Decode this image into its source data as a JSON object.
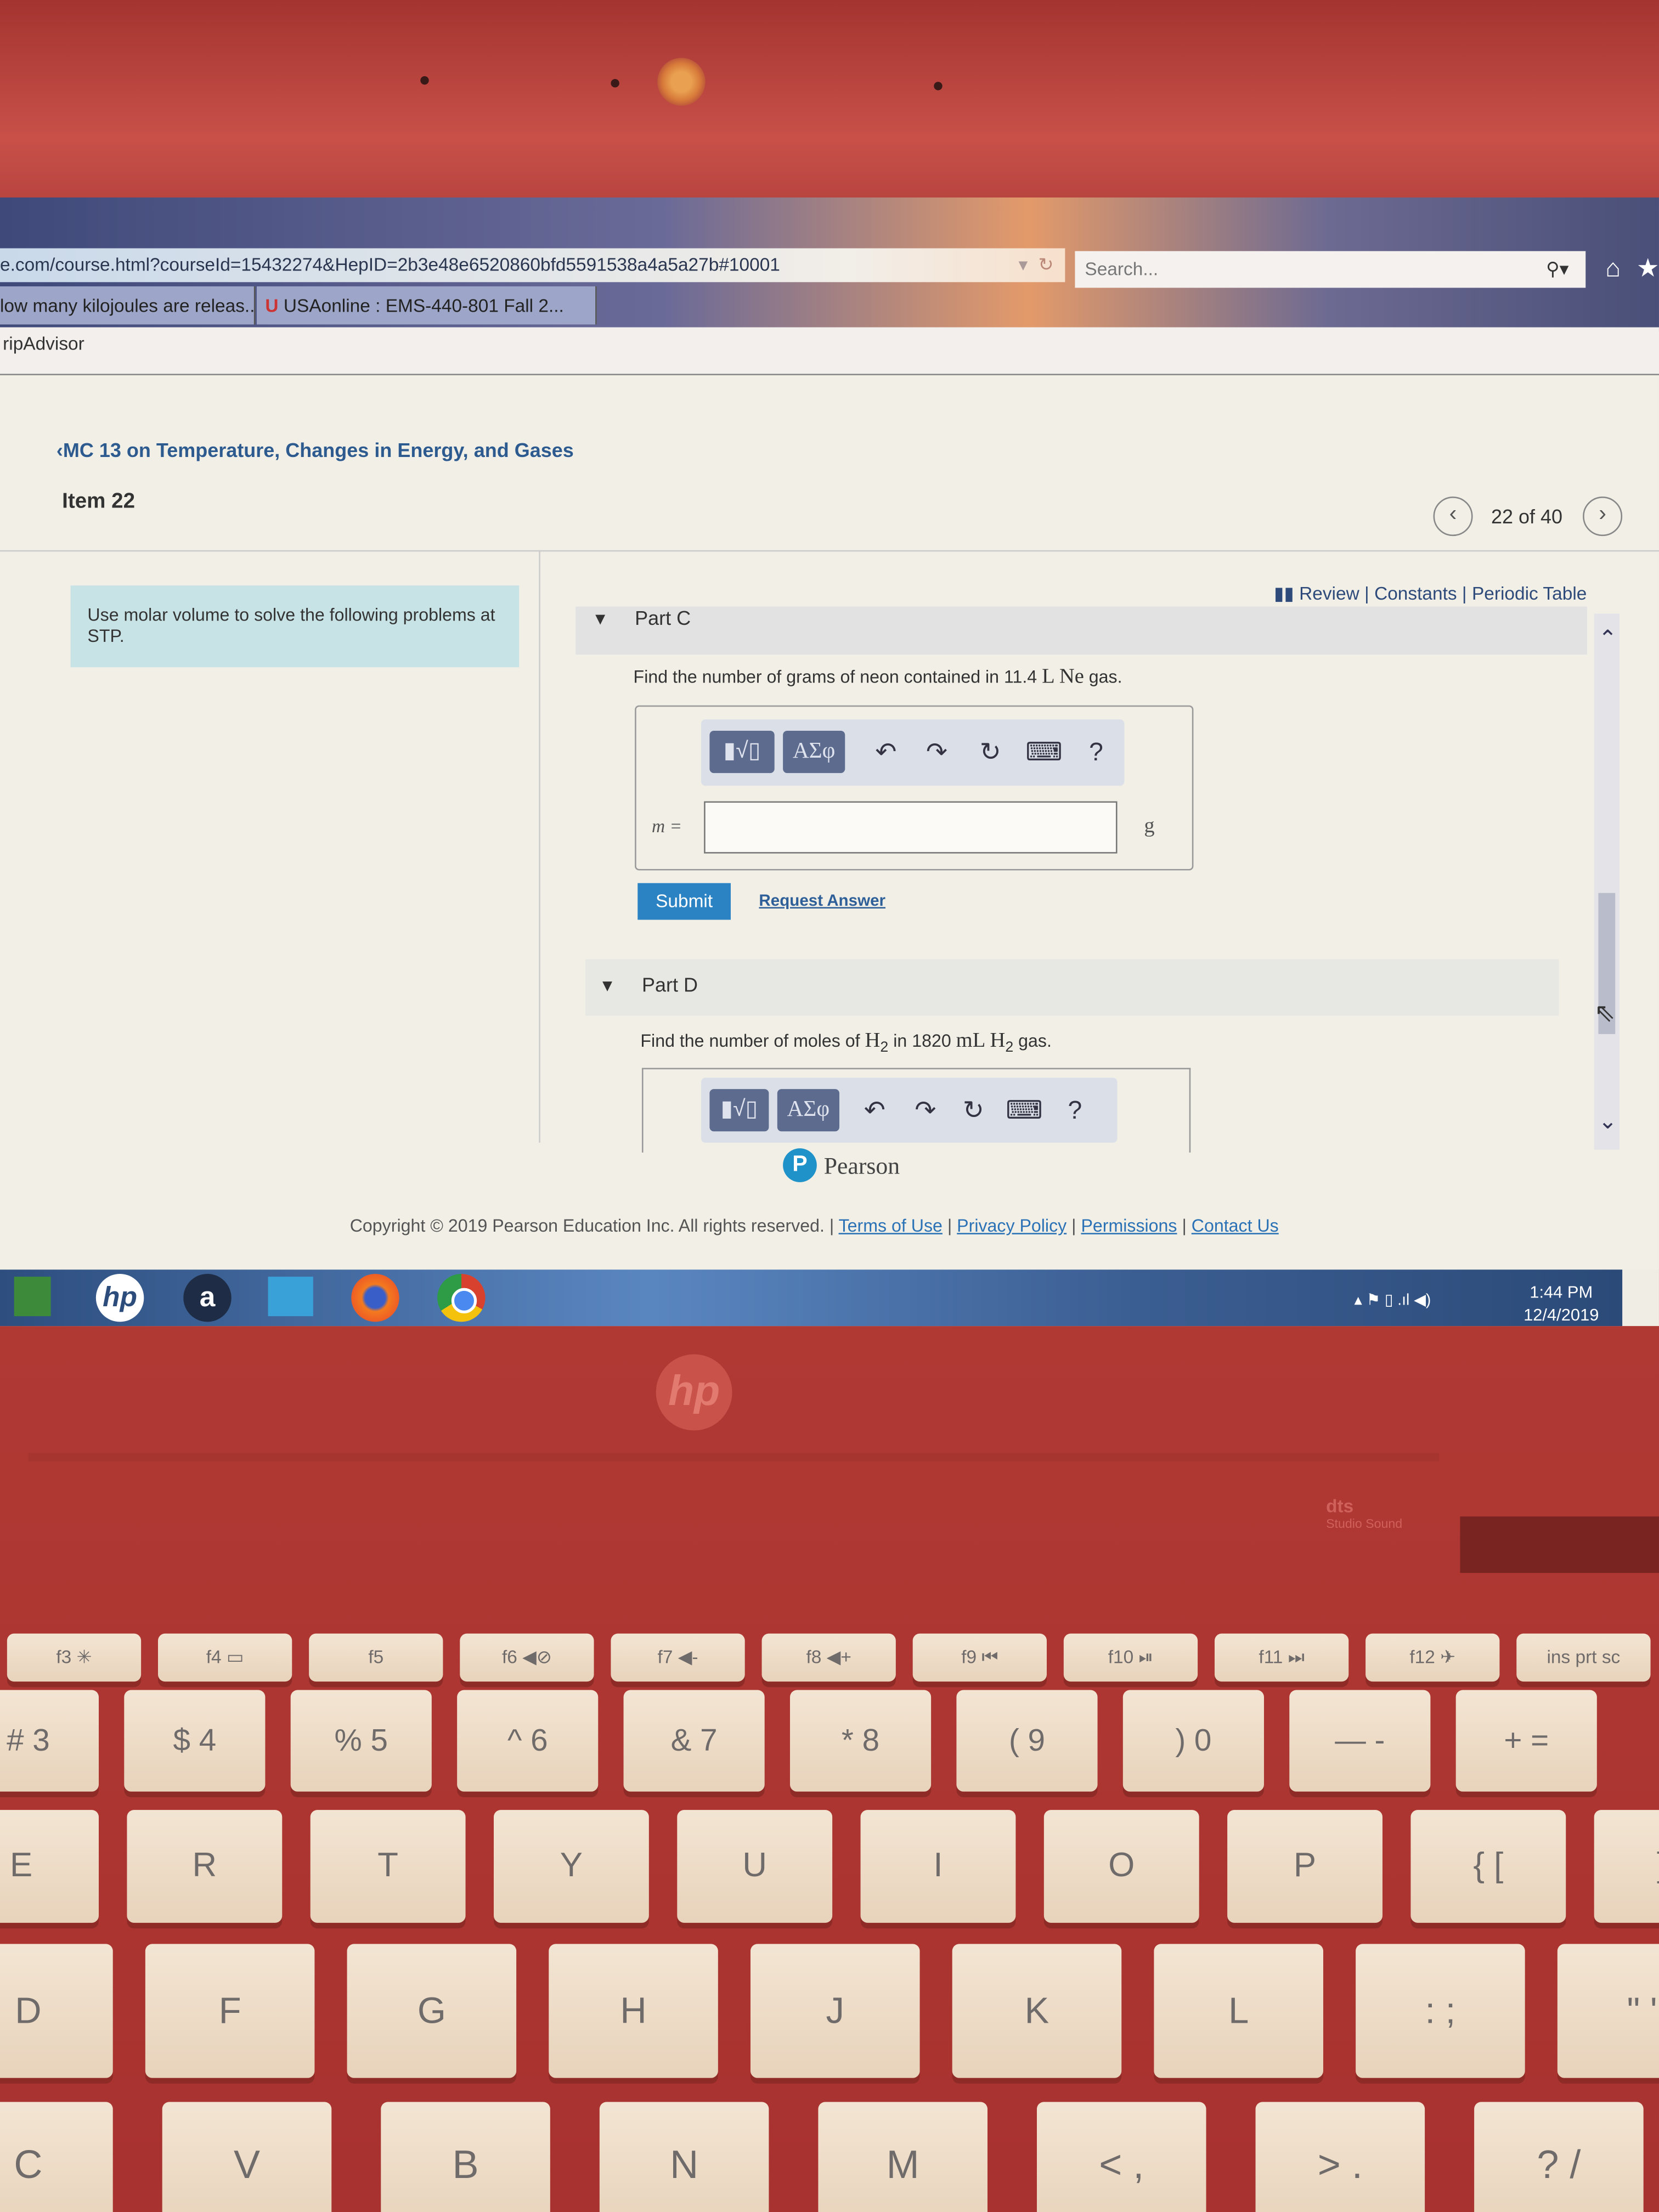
{
  "browser": {
    "url": "e.com/course.html?courseId=15432274&HepID=2b3e48e6520860bfd5591538a4a5a27b#10001",
    "search_placeholder": "Search...",
    "tabs": [
      {
        "label": "low many kilojoules are releas..."
      },
      {
        "label": "USAonline : EMS-440-801 Fall 2..."
      }
    ],
    "bookmark": "ripAdvisor"
  },
  "page": {
    "back_link": "MC 13 on Temperature, Changes in Energy, and Gases",
    "item_title": "Item 22",
    "pagination": "22 of 40",
    "intro": "Use molar volume to solve the following problems at STP.",
    "resources": {
      "review": "Review",
      "constants": "Constants",
      "periodic_table": "Periodic Table",
      "sep": "|"
    },
    "part_c": {
      "title": "Part C",
      "question_pre": "Find the number of grams of neon contained in 11.4 ",
      "question_unit": "L Ne",
      "question_post": " gas.",
      "toolbar": {
        "templates": "▮√▯",
        "greek": "ΑΣφ",
        "undo": "↶",
        "redo": "↷",
        "reset": "↻",
        "keyboard": "⌨",
        "help": "?"
      },
      "variable": "m =",
      "answer_value": "",
      "unit": "g",
      "submit": "Submit",
      "request_answer": "Request Answer"
    },
    "part_d": {
      "title": "Part D",
      "question_pre": "Find the number of moles of ",
      "h2_a": "H",
      "sub_a": "2",
      "mid": " in 1820 ",
      "unit": "mL H",
      "sub_b": "2",
      "question_post": " gas.",
      "toolbar": {
        "templates": "▮√▯",
        "greek": "ΑΣφ",
        "undo": "↶",
        "redo": "↷",
        "reset": "↻",
        "keyboard": "⌨",
        "help": "?"
      }
    },
    "pearson_logo": "Pearson",
    "footer": {
      "copyright": "Copyright © 2019 Pearson Education Inc. All rights reserved.",
      "links": [
        "Terms of Use",
        "Privacy Policy",
        "Permissions",
        "Contact Us"
      ]
    }
  },
  "taskbar": {
    "apps": [
      "store",
      "hp",
      "amazon",
      "weather",
      "firefox",
      "chrome"
    ],
    "amazon_label": "a",
    "hp_label": "hp",
    "time": "1:44 PM",
    "date": "12/4/2019"
  },
  "laptop": {
    "logo": "hp",
    "audio_badge": "dts",
    "audio_sub": "Studio Sound",
    "keys": {
      "fn": [
        "f3 ✳",
        "f4 ▭",
        "f5",
        "f6 ◀⊘",
        "f7 ◀-",
        "f8 ◀+",
        "f9 ⏮",
        "f10 ⏯",
        "f11 ⏭",
        "f12 ✈",
        "ins prt sc"
      ],
      "num": [
        "# 3",
        "$ 4",
        "% 5",
        "^ 6",
        "& 7",
        "* 8",
        "( 9",
        ") 0",
        "— -",
        "+ ="
      ],
      "top": [
        "E",
        "R",
        "T",
        "Y",
        "U",
        "I",
        "O",
        "P",
        "{ [",
        "} ]"
      ],
      "home": [
        "D",
        "F",
        "G",
        "H",
        "J",
        "K",
        "L",
        ": ;",
        "\" '"
      ],
      "bottom": [
        "C",
        "V",
        "B",
        "N",
        "M",
        "< ,",
        "> .",
        "? /"
      ]
    }
  }
}
